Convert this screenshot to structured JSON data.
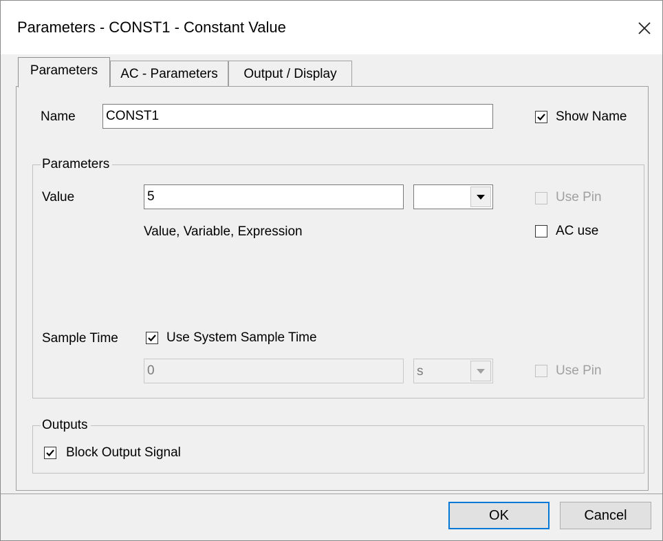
{
  "window": {
    "title": "Parameters - CONST1 - Constant Value"
  },
  "tabs": [
    {
      "label": "Parameters",
      "active": true
    },
    {
      "label": "AC - Parameters",
      "active": false
    },
    {
      "label": "Output / Display",
      "active": false
    }
  ],
  "name_row": {
    "label": "Name",
    "value": "CONST1",
    "show_name_label": "Show Name",
    "show_name_checked": true
  },
  "parameters_group": {
    "legend": "Parameters",
    "value_label": "Value",
    "value": "5",
    "unit_selected": "",
    "use_pin_label": "Use Pin",
    "use_pin_checked": false,
    "hint": "Value, Variable, Expression",
    "ac_use_label": "AC use",
    "ac_use_checked": false,
    "sample_time_label": "Sample Time",
    "use_system_sample_time_label": "Use System Sample Time",
    "use_system_sample_time_checked": true,
    "sample_time_value": "0",
    "sample_time_unit": "s",
    "sample_use_pin_label": "Use Pin",
    "sample_use_pin_checked": false
  },
  "outputs_group": {
    "legend": "Outputs",
    "block_output_label": "Block Output Signal",
    "block_output_checked": true
  },
  "buttons": {
    "ok": "OK",
    "cancel": "Cancel"
  },
  "icons": {
    "close": "close-icon",
    "check": "checkmark-icon",
    "dropdown": "chevron-down-icon"
  }
}
